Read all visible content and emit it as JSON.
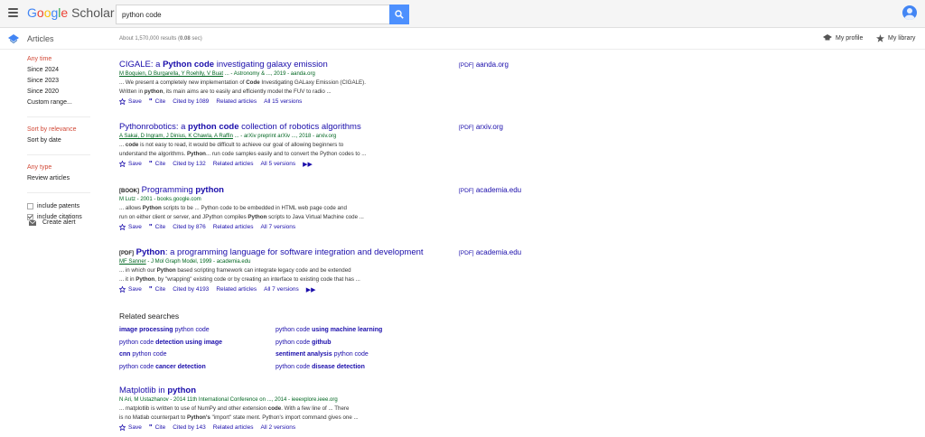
{
  "header": {
    "logo_google": "Google",
    "logo_scholar": "Scholar",
    "search_value": "python code",
    "colors": {
      "accent": "#4d90fe",
      "avatar": "#4285f4",
      "link": "#1a0dab",
      "source": "#006621",
      "active": "#d14836"
    }
  },
  "subheader": {
    "section_label": "Articles",
    "results_prefix": "About 1,570,000 results (",
    "results_time": "0.08",
    "results_suffix": " sec)",
    "my_profile": "My profile",
    "my_library": "My library"
  },
  "sidebar": {
    "time": [
      "Any time",
      "Since 2024",
      "Since 2023",
      "Since 2020",
      "Custom range..."
    ],
    "sort": [
      "Sort by relevance",
      "Sort by date"
    ],
    "type": [
      "Any type",
      "Review articles"
    ],
    "include_patents": "include patents",
    "include_citations": "include citations",
    "create_alert": "Create alert"
  },
  "results": [
    {
      "tag": "",
      "title_pre": "CIGALE: a ",
      "title_bold": "Python code",
      "title_post": " investigating galaxy emission",
      "authors_links": "M Boquien, D Burgarella, Y Roehlly, V Buat",
      "authors_rest": "... - Astronomy & ..., 2019 - aanda.org",
      "snippet1_pre": "... We present a completely new implementation of ",
      "snippet1_bold": "Code",
      "snippet1_post": " Investigating GALaxy Emission (CIGALE).",
      "snippet2_pre": "Written in ",
      "snippet2_bold": "python",
      "snippet2_post": ", its main aims are to easily and efficiently model the FUV to radio ...",
      "save": "Save",
      "cite": "Cite",
      "cited_by": "Cited by 1089",
      "related": "Related articles",
      "versions": "All 15 versions",
      "pdf_tag": "[PDF]",
      "pdf_host": "aanda.org"
    },
    {
      "tag": "",
      "title_pre": "Pythonrobotics: a ",
      "title_bold": "python code",
      "title_post": " collection of robotics algorithms",
      "authors_links": "A Sakai, D Ingram, J Dinius, K Chawla, A Raffin",
      "authors_rest": "... - arXiv preprint arXiv ..., 2018 - arxiv.org",
      "snippet1_pre": "... ",
      "snippet1_bold": "code",
      "snippet1_post": " is not easy to read, it would be difficult to achieve our goal of allowing beginners to",
      "snippet2_pre": "understand the algorithms. ",
      "snippet2_bold": "Python",
      "snippet2_post": "... run code samples easily and to convert the Python codes to ...",
      "save": "Save",
      "cite": "Cite",
      "cited_by": "Cited by 132",
      "related": "Related articles",
      "versions": "All 5 versions",
      "pdf_tag": "[PDF]",
      "pdf_host": "arxiv.org"
    },
    {
      "tag": "[BOOK]",
      "title_pre": " Programming ",
      "title_bold": "python",
      "title_post": "",
      "authors_links": "",
      "authors_rest": "M Lutz - 2001 - books.google.com",
      "snippet1_pre": "... allows ",
      "snippet1_bold": "Python",
      "snippet1_post": " scripts to be ... Python code to be embedded in HTML web page code and",
      "snippet2_pre": "run on either client or server, and JPython compiles ",
      "snippet2_bold": "Python",
      "snippet2_post": " scripts to Java Virtual Machine code ...",
      "save": "Save",
      "cite": "Cite",
      "cited_by": "Cited by 876",
      "related": "Related articles",
      "versions": "All 7 versions",
      "pdf_tag": "[PDF]",
      "pdf_host": "academia.edu"
    },
    {
      "tag": "[PDF]",
      "title_pre": " ",
      "title_bold": "Python",
      "title_post": ": a programming language for software integration and development",
      "authors_links": "MF Sanner",
      "authors_rest": " - J Mol Graph Model, 1999 - academia.edu",
      "snippet1_pre": "... in which our ",
      "snippet1_bold": "Python",
      "snippet1_post": " based scripting framework can integrate legacy code and be extended",
      "snippet2_pre": "... it in ",
      "snippet2_bold": "Python",
      "snippet2_post": ", by \"wrapping\" existing code or by creating an interface to existing code that has ...",
      "save": "Save",
      "cite": "Cite",
      "cited_by": "Cited by 4193",
      "related": "Related articles",
      "versions": "All 7 versions",
      "pdf_tag": "[PDF]",
      "pdf_host": "academia.edu"
    },
    {
      "tag": "",
      "title_pre": "Matplotlib in ",
      "title_bold": "python",
      "title_post": "",
      "authors_links": "",
      "authors_rest": "N Ari, M Ustazhanov - 2014 11th International Conference on ..., 2014 - ieeexplore.ieee.org",
      "snippet1_pre": "... matplotlib is written to use of NumPy and other extension ",
      "snippet1_bold": "code",
      "snippet1_post": ". With a few line of ... There",
      "snippet2_pre": "is no Matlab counterpart to ",
      "snippet2_bold": "Python's",
      "snippet2_post": " \"import\" state ment. Python's import command gives one ...",
      "save": "Save",
      "cite": "Cite",
      "cited_by": "Cited by 143",
      "related": "Related articles",
      "versions": "All 2 versions",
      "pdf_tag": "",
      "pdf_host": ""
    }
  ],
  "related_searches": {
    "title": "Related searches",
    "items": [
      {
        "bold": "image processing",
        "plain": " python code",
        "bold_first": true
      },
      {
        "plain": "python code ",
        "bold": "using machine learning",
        "bold_first": false
      },
      {
        "plain": "python code ",
        "bold": "detection using image",
        "bold_first": false
      },
      {
        "plain": "python code ",
        "bold": "github",
        "bold_first": false
      },
      {
        "bold": "cnn",
        "plain": " python code",
        "bold_first": true
      },
      {
        "bold": "sentiment analysis",
        "plain": " python code",
        "bold_first": true
      },
      {
        "plain": "python code ",
        "bold": "cancer detection",
        "bold_first": false
      },
      {
        "plain": "python code ",
        "bold": "disease detection",
        "bold_first": false
      }
    ]
  }
}
